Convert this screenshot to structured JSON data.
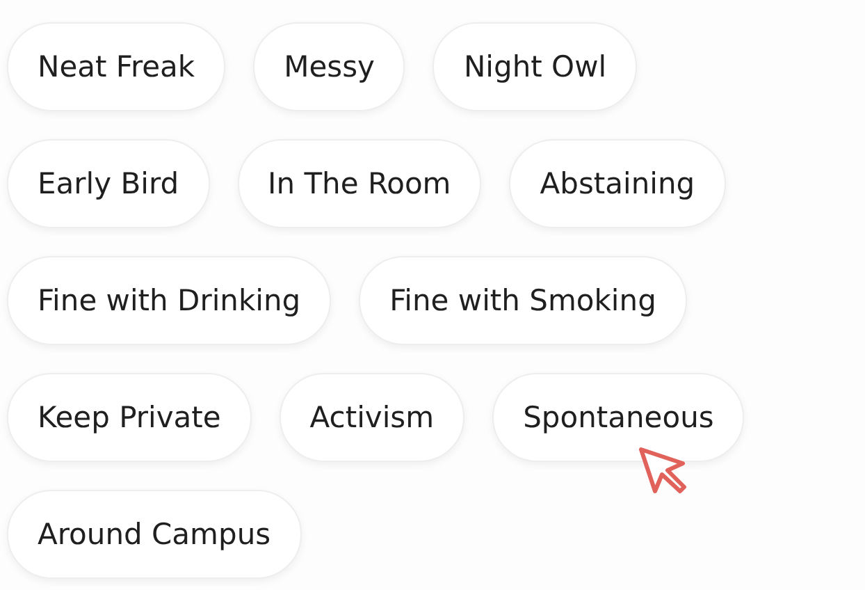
{
  "tag_rows": [
    {
      "tags": [
        "Neat Freak",
        "Messy",
        "Night Owl"
      ]
    },
    {
      "tags": [
        "Early Bird",
        "In The Room",
        "Abstaining"
      ]
    },
    {
      "tags": [
        "Fine with Drinking",
        "Fine with Smoking"
      ]
    },
    {
      "tags": [
        "Keep Private",
        "Activism",
        "Spontaneous"
      ]
    },
    {
      "tags": [
        "Around Campus"
      ]
    }
  ]
}
